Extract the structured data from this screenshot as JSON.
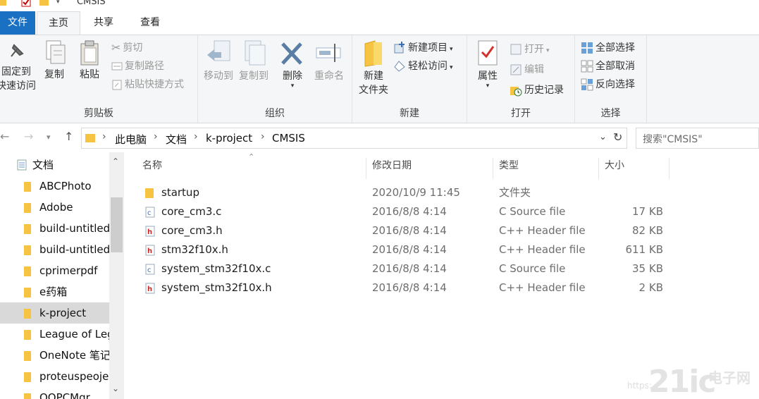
{
  "window": {
    "title": "CMSIS"
  },
  "tabs": {
    "file": "文件",
    "home": "主页",
    "share": "共享",
    "view": "查看"
  },
  "ribbon": {
    "clipboard": {
      "label": "剪贴板",
      "pin_line1": "固定到",
      "pin_line2": "快速访问",
      "copy": "复制",
      "paste": "粘贴",
      "cut": "剪切",
      "copy_path": "复制路径",
      "paste_shortcut": "粘贴快捷方式"
    },
    "organize": {
      "label": "组织",
      "move_to": "移动到",
      "copy_to": "复制到",
      "delete": "删除",
      "rename": "重命名"
    },
    "new": {
      "label": "新建",
      "new_folder_line1": "新建",
      "new_folder_line2": "文件夹",
      "new_item": "新建项目",
      "easy_access": "轻松访问"
    },
    "open": {
      "label": "打开",
      "properties": "属性",
      "open": "打开",
      "edit": "编辑",
      "history": "历史记录"
    },
    "select": {
      "label": "选择",
      "select_all": "全部选择",
      "select_none": "全部取消",
      "invert": "反向选择"
    }
  },
  "address": {
    "crumbs": [
      "此电脑",
      "文档",
      "k-project",
      "CMSIS"
    ],
    "search_placeholder": "搜索\"CMSIS\""
  },
  "navpane": {
    "items": [
      {
        "label": "文档"
      },
      {
        "label": "ABCPhoto"
      },
      {
        "label": "Adobe"
      },
      {
        "label": "build-untitled"
      },
      {
        "label": "build-untitled"
      },
      {
        "label": "cprimerpdf"
      },
      {
        "label": "e药箱"
      },
      {
        "label": "k-project"
      },
      {
        "label": "League of Leg"
      },
      {
        "label": "OneNote 笔记"
      },
      {
        "label": "proteuspeoje"
      },
      {
        "label": "QQPCMgr"
      }
    ]
  },
  "filelist": {
    "headers": {
      "name": "名称",
      "modified": "修改日期",
      "type": "类型",
      "size": "大小"
    },
    "rows": [
      {
        "name": "startup",
        "modified": "2020/10/9 11:45",
        "type": "文件夹",
        "size": "",
        "icon": "folder-icon"
      },
      {
        "name": "core_cm3.c",
        "modified": "2016/8/8 4:14",
        "type": "C Source file",
        "size": "17 KB",
        "icon": "c-file-icon"
      },
      {
        "name": "core_cm3.h",
        "modified": "2016/8/8 4:14",
        "type": "C++ Header file",
        "size": "82 KB",
        "icon": "h-file-icon"
      },
      {
        "name": "stm32f10x.h",
        "modified": "2016/8/8 4:14",
        "type": "C++ Header file",
        "size": "611 KB",
        "icon": "h-file-icon"
      },
      {
        "name": "system_stm32f10x.c",
        "modified": "2016/8/8 4:14",
        "type": "C Source file",
        "size": "35 KB",
        "icon": "c-file-icon"
      },
      {
        "name": "system_stm32f10x.h",
        "modified": "2016/8/8 4:14",
        "type": "C++ Header file",
        "size": "2 KB",
        "icon": "h-file-icon"
      }
    ]
  },
  "watermark": {
    "text": "21ic",
    "cn": "电子网",
    "url": "https:"
  },
  "colors": {
    "accent": "#1a70c2",
    "folder": "#f6c343",
    "selection": "#d9d9d9"
  }
}
